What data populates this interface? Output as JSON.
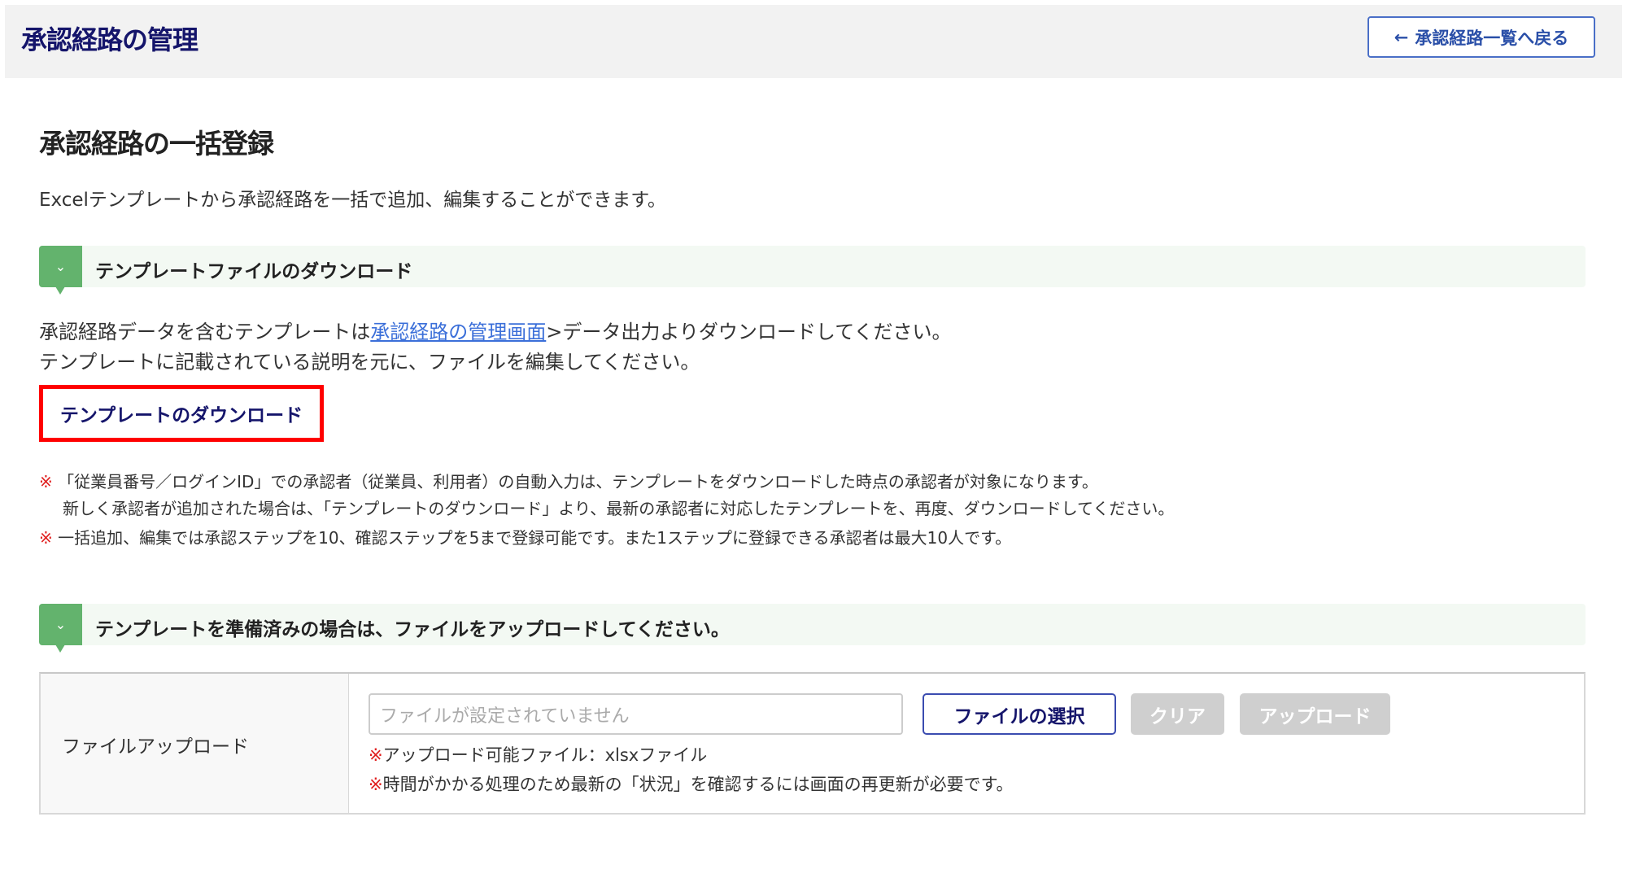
{
  "header": {
    "title": "承認経路の管理",
    "back_button": "承認経路一覧へ戻る"
  },
  "page": {
    "title": "承認経路の一括登録",
    "description": "Excelテンプレートから承認経路を一括で追加、編集することができます。"
  },
  "download_section": {
    "heading": "テンプレートファイルのダウンロード",
    "line1_before": "承認経路データを含むテンプレートは",
    "line1_link": "承認経路の管理画面",
    "line1_after": ">データ出力よりダウンロードしてください。",
    "line2": "テンプレートに記載されている説明を元に、ファイルを編集してください。",
    "download_button": "テンプレートのダウンロード",
    "note_mark": "※",
    "note1a": "「従業員番号／ログインID」での承認者（従業員、利用者）の自動入力は、テンプレートをダウンロードした時点の承認者が対象になります。",
    "note1b": "新しく承認者が追加された場合は、「テンプレートのダウンロード」より、最新の承認者に対応したテンプレートを、再度、ダウンロードしてください。",
    "note2": "一括追加、編集では承認ステップを10、確認ステップを5まで登録可能です。また1ステップに登録できる承認者は最大10人です。"
  },
  "upload_section": {
    "heading": "テンプレートを準備済みの場合は、ファイルをアップロードしてください。",
    "row_label": "ファイルアップロード",
    "file_placeholder": "ファイルが設定されていません",
    "select_button": "ファイルの選択",
    "clear_button": "クリア",
    "upload_button": "アップロード",
    "note1": "アップロード可能ファイル：xlsxファイル",
    "note2": "時間がかかる処理のため最新の「状況」を確認するには画面の再更新が必要です。"
  }
}
